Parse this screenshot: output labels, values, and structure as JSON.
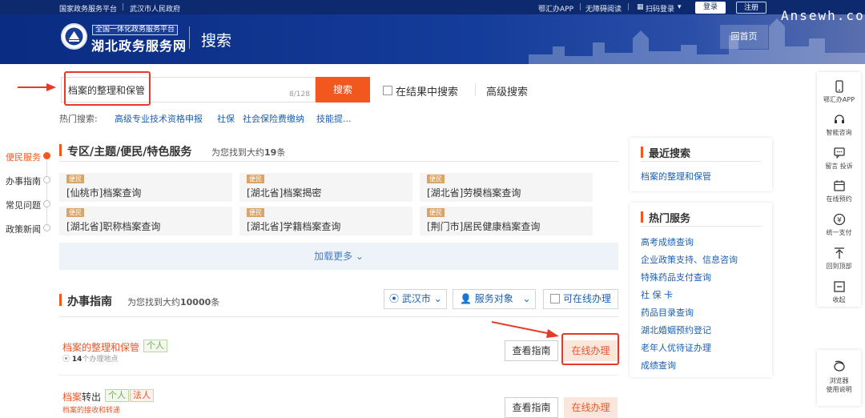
{
  "topbar": {
    "left_links": [
      "国家政务服务平台",
      "武汉市人民政府"
    ],
    "separator": "|",
    "app": "鄂汇办APP",
    "accessible": "无障碍阅读",
    "scan_login": "扫码登录",
    "login": "登录",
    "register": "注册"
  },
  "header": {
    "logo_sub": "全国一体化政务服务平台",
    "logo_main": "湖北政务服务网",
    "title": "搜索",
    "home_button": "回首页",
    "watermark": "Ansewh.com"
  },
  "search": {
    "value": "档案的整理和保管",
    "counter": "8/128",
    "button": "搜索",
    "in_results": "在结果中搜索",
    "advanced": "高级搜索",
    "hot_label": "热门搜索:",
    "hot_items": [
      "高级专业技术资格申报",
      "社保",
      "社会保险费缴纳",
      "技能提..."
    ]
  },
  "left_nav": [
    "便民服务",
    "办事指南",
    "常见问题",
    "政策新闻"
  ],
  "section1": {
    "title": "专区/主题/便民/特色服务",
    "found_prefix": "为您找到大约",
    "found_count": "19",
    "found_suffix": "条",
    "cards": [
      {
        "tag": "便民",
        "text": "[仙桃市]档案查询"
      },
      {
        "tag": "便民",
        "text": "[湖北省]档案揭密"
      },
      {
        "tag": "便民",
        "text": "[湖北省]劳模档案查询"
      },
      {
        "tag": "便民",
        "text": "[湖北省]职称档案查询"
      },
      {
        "tag": "便民",
        "text": "[湖北省]学籍档案查询"
      },
      {
        "tag": "便民",
        "text": "[荆门市]居民健康档案查询"
      }
    ],
    "load_more": "加载更多 ⌄"
  },
  "section2": {
    "title": "办事指南",
    "found_prefix": "为您找到大约",
    "found_count": "10000",
    "found_suffix": "条",
    "filter_city": "武汉市",
    "filter_target": "服务对象",
    "filter_online": "可在线办理",
    "rows": [
      {
        "title_hl": "档案的整理和保管",
        "title_rest": "",
        "tags": [
          "个人"
        ],
        "sub_count": "14",
        "sub_text": "个办理地点",
        "guide": "查看指南",
        "online": "在线办理"
      },
      {
        "title_hl": "档案",
        "title_rest": "转出",
        "tags": [
          "个人",
          "法人"
        ],
        "sub_text": "档案的接收和转递",
        "guide": "查看指南",
        "online": "在线办理"
      }
    ]
  },
  "recent": {
    "title": "最近搜索",
    "items": [
      "档案的整理和保管"
    ]
  },
  "hot_services": {
    "title": "热门服务",
    "items": [
      "高考成绩查询",
      "企业政策支持、信息咨询",
      "特殊药品支付查询",
      "社 保 卡",
      "药品目录查询",
      "湖北婚姻预约登记",
      "老年人优待证办理",
      "成绩查询"
    ]
  },
  "sidebar": [
    "鄂汇办APP",
    "智能咨询",
    "留言 投诉",
    "在线预约",
    "统一支付",
    "回到顶部",
    "收起"
  ],
  "browser_help": [
    "浏览器",
    "使用说明"
  ],
  "colors": {
    "accent": "#f2571d",
    "link": "#1a5fb4",
    "header": "#0e2a6e",
    "highlight_red": "#e53a2a"
  }
}
